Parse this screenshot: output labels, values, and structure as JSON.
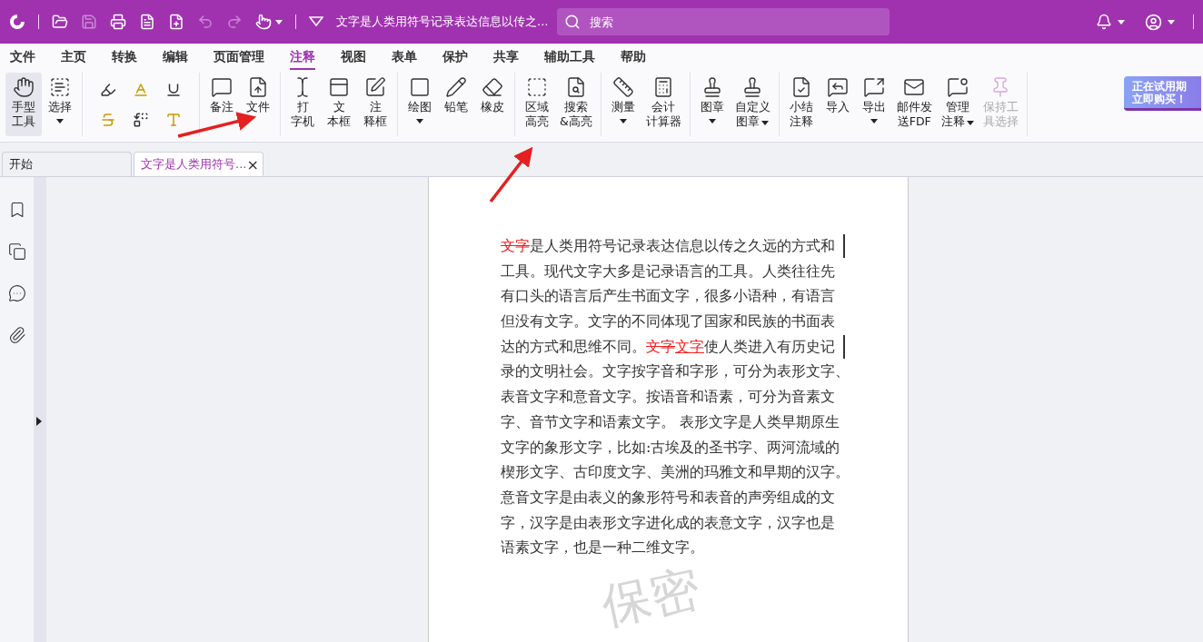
{
  "title_bar": {
    "document_title": "文字是人类用符号记录表达信息以传之...",
    "search": {
      "placeholder": "搜索"
    },
    "quick_tools": [
      {
        "disabled": false
      },
      {
        "disabled": true
      },
      {
        "disabled": false
      },
      {
        "disabled": false
      },
      {
        "disabled": false
      },
      {
        "disabled": true
      },
      {
        "disabled": true
      }
    ]
  },
  "menu": [
    {
      "label": "文件",
      "selected": false
    },
    {
      "label": "主页",
      "selected": false
    },
    {
      "label": "转换",
      "selected": false
    },
    {
      "label": "编辑",
      "selected": false
    },
    {
      "label": "页面管理",
      "selected": false
    },
    {
      "label": "注释",
      "selected": true
    },
    {
      "label": "视图",
      "selected": false
    },
    {
      "label": "表单",
      "selected": false
    },
    {
      "label": "保护",
      "selected": false
    },
    {
      "label": "共享",
      "selected": false
    },
    {
      "label": "辅助工具",
      "selected": false
    },
    {
      "label": "帮助",
      "selected": false
    }
  ],
  "ribbon": {
    "groups": [
      {
        "tools": [
          {
            "kind": "large",
            "lines": [
              "手型",
              "工具"
            ],
            "selected": true,
            "disabled": false
          },
          {
            "kind": "large",
            "lines": [
              "选择"
            ],
            "selected": false,
            "disabled": false,
            "dropdown": true
          }
        ]
      },
      {
        "tools": [
          {
            "kind": "small"
          },
          {
            "kind": "small"
          },
          {
            "kind": "small"
          },
          {
            "kind": "small"
          },
          {
            "kind": "small"
          },
          {
            "kind": "small"
          }
        ]
      },
      {
        "tools": [
          {
            "kind": "large",
            "lines": [
              "备注"
            ],
            "selected": false,
            "disabled": false
          },
          {
            "kind": "large",
            "lines": [
              "文件"
            ],
            "selected": false,
            "disabled": false
          }
        ]
      },
      {
        "tools": [
          {
            "kind": "large",
            "lines": [
              "打",
              "字机"
            ],
            "selected": false,
            "disabled": false
          },
          {
            "kind": "large",
            "lines": [
              "文",
              "本框"
            ],
            "selected": false,
            "disabled": false
          },
          {
            "kind": "large",
            "lines": [
              "注",
              "释框"
            ],
            "selected": false,
            "disabled": false
          }
        ]
      },
      {
        "tools": [
          {
            "kind": "large",
            "lines": [
              "绘图"
            ],
            "selected": false,
            "disabled": false,
            "dropdown": true
          },
          {
            "kind": "large",
            "lines": [
              "铅笔"
            ],
            "selected": false,
            "disabled": false
          },
          {
            "kind": "large",
            "lines": [
              "橡皮"
            ],
            "selected": false,
            "disabled": false
          }
        ]
      },
      {
        "tools": [
          {
            "kind": "large",
            "lines": [
              "区域",
              "高亮"
            ],
            "selected": false,
            "disabled": false
          },
          {
            "kind": "large",
            "lines": [
              "搜索",
              "&高亮"
            ],
            "selected": false,
            "disabled": false
          }
        ]
      },
      {
        "tools": [
          {
            "kind": "large",
            "lines": [
              "测量"
            ],
            "selected": false,
            "disabled": false,
            "dropdown": true
          },
          {
            "kind": "large",
            "lines": [
              "会计",
              "计算器"
            ],
            "selected": false,
            "disabled": false
          }
        ]
      },
      {
        "tools": [
          {
            "kind": "large",
            "lines": [
              "图章"
            ],
            "selected": false,
            "disabled": false,
            "dropdown": true
          },
          {
            "kind": "large",
            "lines": [
              "自定义",
              "图章"
            ],
            "selected": false,
            "disabled": false,
            "dropdown_inline": true
          }
        ]
      },
      {
        "tools": [
          {
            "kind": "large",
            "lines": [
              "小结",
              "注释"
            ],
            "selected": false,
            "disabled": false
          },
          {
            "kind": "large",
            "lines": [
              "导入"
            ],
            "selected": false,
            "disabled": false
          },
          {
            "kind": "large",
            "lines": [
              "导出"
            ],
            "selected": false,
            "disabled": false,
            "dropdown": true
          },
          {
            "kind": "large",
            "lines": [
              "邮件发",
              "送FDF"
            ],
            "selected": false,
            "disabled": false
          },
          {
            "kind": "large",
            "lines": [
              "管理",
              "注释"
            ],
            "selected": false,
            "disabled": false,
            "dropdown_inline": true
          },
          {
            "kind": "large",
            "lines": [
              "保持工",
              "具选择"
            ],
            "selected": false,
            "disabled": true
          }
        ]
      }
    ],
    "trial_badge": [
      "正在试用期",
      "立即购买！"
    ]
  },
  "doc_tabs": [
    {
      "label": "开始",
      "selected": false
    },
    {
      "label": "文字是人类用符号...",
      "selected": true,
      "close": "×"
    }
  ],
  "document": {
    "watermark": "保密",
    "lines": [
      {
        "change_bar": true,
        "segments": [
          {
            "kind": "strike",
            "text": "文字"
          },
          {
            "kind": "plain",
            "text": "是人类用符号记录表达信息以传之久远的方式和"
          }
        ]
      },
      {
        "segments": [
          {
            "kind": "plain",
            "text": "工具。现代文字大多是记录语言的工具。人类往往先"
          }
        ]
      },
      {
        "segments": [
          {
            "kind": "plain",
            "text": "有口头的语言后产生书面文字，很多小语种，有语言"
          }
        ]
      },
      {
        "segments": [
          {
            "kind": "plain",
            "text": "但没有文字。文字的不同体现了国家和民族的书面表"
          }
        ]
      },
      {
        "change_bar": true,
        "segments": [
          {
            "kind": "plain",
            "text": "达的方式和思维不同。"
          },
          {
            "kind": "strike",
            "text": "文字"
          },
          {
            "kind": "underline",
            "text": "文字"
          },
          {
            "kind": "plain",
            "text": "使人类进入有历史记"
          }
        ]
      },
      {
        "segments": [
          {
            "kind": "plain",
            "text": "录的文明社会。文字按字音和字形，可分为表形文字、"
          }
        ]
      },
      {
        "segments": [
          {
            "kind": "plain",
            "text": "表音文字和意音文字。按语音和语素，可分为音素文"
          }
        ]
      },
      {
        "segments": [
          {
            "kind": "plain",
            "text": "字、音节文字和语素文字。 表形文字是人类早期原生"
          }
        ]
      },
      {
        "segments": [
          {
            "kind": "plain",
            "text": "文字的象形文字，比如:古埃及的圣书字、两河流域的"
          }
        ]
      },
      {
        "segments": [
          {
            "kind": "plain",
            "text": "楔形文字、古印度文字、美洲的玛雅文和早期的汉字。"
          }
        ]
      },
      {
        "segments": [
          {
            "kind": "plain",
            "text": "意音文字是由表义的象形符号和表音的声旁组成的文"
          }
        ]
      },
      {
        "segments": [
          {
            "kind": "plain",
            "text": "字，汉字是由表形文字进化成的表意文字，汉字也是"
          }
        ]
      },
      {
        "segments": [
          {
            "kind": "plain",
            "text": "语素文字，也是一种二维文字。"
          }
        ]
      }
    ]
  }
}
